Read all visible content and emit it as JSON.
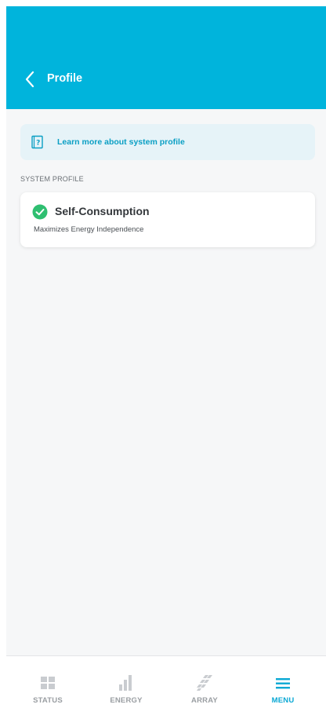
{
  "header": {
    "title": "Profile"
  },
  "banner": {
    "text": "Learn more about system profile"
  },
  "section": {
    "label": "SYSTEM PROFILE"
  },
  "profile": {
    "name": "Self-Consumption",
    "description": "Maximizes Energy Independence",
    "selected": true
  },
  "tabs": [
    {
      "label": "STATUS",
      "icon": "grid-icon",
      "active": false
    },
    {
      "label": "ENERGY",
      "icon": "bar-chart-icon",
      "active": false
    },
    {
      "label": "ARRAY",
      "icon": "solar-panel-icon",
      "active": false
    },
    {
      "label": "MENU",
      "icon": "hamburger-menu-icon",
      "active": true
    }
  ],
  "colors": {
    "brand": "#00b4dc",
    "accent": "#0aa8d4",
    "success": "#2fbf71"
  }
}
